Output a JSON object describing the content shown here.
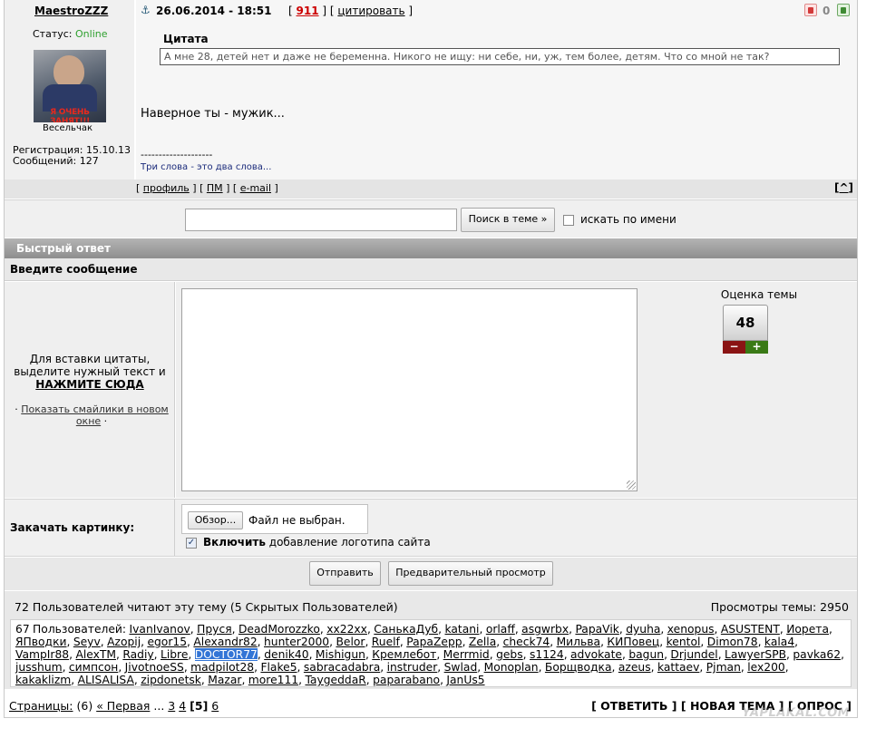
{
  "post": {
    "username": "MaestroZZZ",
    "status_label": "Статус:",
    "status_value": "Online",
    "avatar_text": "Я ОЧЕНЬ ЗАНЯТ!!!",
    "user_title": "Весельчак",
    "reg_label": "Регистрация:",
    "reg_date": "15.10.13",
    "msgs_label": "Сообщений:",
    "msgs_count": "127",
    "datetime": "26.06.2014 - 18:51",
    "post_number": "911",
    "quote_link": "цитировать",
    "rating_value": "0",
    "quote_title": "Цитата",
    "quote_text": "А мне 28, детей нет и даже не беременна. Никого не ищу: ни себе, ни, уж, тем более, детям. Что со мной не так?",
    "body": "Наверное ты - мужик...",
    "sig_sep": "--------------------",
    "signature": "Три слова - это два слова...",
    "footer_profile": "профиль",
    "footer_pm": "ПМ",
    "footer_email": "e-mail",
    "top_link": "^"
  },
  "search": {
    "button": "Поиск в теме »",
    "by_name": "искать по имени"
  },
  "quick_reply": {
    "header": "Быстрый ответ",
    "subheader": "Введите сообщение",
    "hint_line1": "Для вставки цитаты,",
    "hint_line2": "выделите нужный текст и",
    "hint_action": "НАЖМИТЕ СЮДА",
    "smilies_link": "Показать смайлики в новом окне",
    "rating_label": "Оценка темы",
    "rating_value": "48",
    "minus": "−",
    "plus": "+"
  },
  "upload": {
    "label": "Закачать картинку:",
    "browse": "Обзор...",
    "no_file": "Файл не выбран.",
    "logo_bold": "Включить",
    "logo_rest": "добавление логотипа сайта"
  },
  "submit": {
    "send": "Отправить",
    "preview": "Предварительный просмотр"
  },
  "readers": {
    "summary": "72 Пользователей читают эту тему (5 Скрытых Пользователей)",
    "views": "Просмотры темы: 2950",
    "users_label": "67 Пользователей:",
    "users": [
      "IvanIvanov",
      "Пруся",
      "DeadMorozzko",
      "xx22xx",
      "СанькаДуб",
      "katani",
      "orlaff",
      "asgwrbx",
      "PapaVik",
      "dyuha",
      "xenopus",
      "ASUSTENT",
      "Иорета",
      "ЯПводки",
      "Seyv",
      "Azopij",
      "egor15",
      "Alexandr82",
      "hunter2000",
      "Belor",
      "Ruelf",
      "PapaZepp",
      "Zella",
      "check74",
      "Мильва",
      "КИПовец",
      "kentol",
      "Dimon78",
      "kala4",
      "VampIr88",
      "AlexTM",
      "Radiy",
      "Libre",
      "DOCTOR77",
      "denik40",
      "Mishigun",
      "Кремлебот",
      "Merrmid",
      "gebs",
      "s1124",
      "advokate",
      "bagun",
      "Drjundel",
      "LawyerSPB",
      "pavka62",
      "jusshum",
      "симпсон",
      "JivotnoeSS",
      "madpilot28",
      "Flake5",
      "sabracadabra",
      "instruder",
      "Swlad",
      "Monoplan",
      "Борщводка",
      "azeus",
      "kattaev",
      "Pjman",
      "lex200",
      "kakaklizm",
      "ALISALISA",
      "zipdonetsk",
      "Mazar",
      "more111",
      "TaygeddaR",
      "paparabano",
      "JanUs5"
    ],
    "highlighted": "DOCTOR77"
  },
  "pages": {
    "label": "Страницы:",
    "count": "(6)",
    "first": "« Первая",
    "dots": "...",
    "p3": "3",
    "p4": "4",
    "current": "[5]",
    "p6": "6",
    "reply": "[ ОТВЕТИТЬ ]",
    "new_topic": "[ НОВАЯ ТЕМА ]",
    "poll": "[ ОПРОС ]"
  },
  "watermark": "YAPLAKAL.COM",
  "colors": {
    "online": "#2ea02e",
    "post_number": "#cc0000",
    "signature": "#1a2a7a",
    "header_bg": "#9c9c9c",
    "highlight": "#3375d6"
  }
}
